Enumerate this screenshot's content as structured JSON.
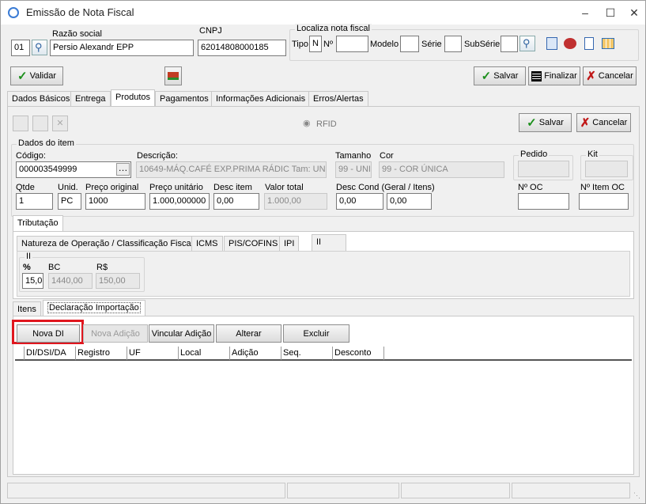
{
  "window": {
    "title": "Emissão de Nota Fiscal"
  },
  "header": {
    "code": "01",
    "razao_social_label": "Razão social",
    "razao_social": "Persio Alexandr EPP",
    "cnpj_label": "CNPJ",
    "cnpj": "62014808000185",
    "localiza_label": "Localiza nota fiscal",
    "tipo_label": "Tipo",
    "tipo": "N",
    "numero_label": "Nº",
    "modelo_label": "Modelo",
    "serie_label": "Série",
    "subserie_label": "SubSérie"
  },
  "toolbar": {
    "validar": "Validar",
    "salvar": "Salvar",
    "finalizar": "Finalizar",
    "cancelar": "Cancelar"
  },
  "tabs": [
    "Dados Básicos",
    "Entrega",
    "Produtos",
    "Pagamentos",
    "Informações Adicionais",
    "Erros/Alertas"
  ],
  "produtos": {
    "rfid": "RFID",
    "salvar": "Salvar",
    "cancelar": "Cancelar",
    "dados_item_label": "Dados do item",
    "codigo_label": "Código:",
    "codigo": "000003549999",
    "descricao_label": "Descrição:",
    "descricao": "10649-MÁQ.CAFÉ EXP.PRIMA RÁDIC Tam: UNI",
    "tamanho_label": "Tamanho",
    "tamanho": "99 - UNI",
    "cor_label": "Cor",
    "cor": "99 - COR ÚNICA",
    "pedido_label": "Pedido",
    "kit_label": "Kit",
    "qtde_label": "Qtde",
    "qtde": "1",
    "unid_label": "Unid.",
    "unid": "PC",
    "preco_original_label": "Preço original",
    "preco_original": "1000",
    "preco_unitario_label": "Preço unitário",
    "preco_unitario": "1.000,000000",
    "desc_item_label": "Desc item",
    "desc_item": "0,00",
    "valor_total_label": "Valor total",
    "valor_total": "1.000,00",
    "desc_cond_label": "Desc Cond (Geral / Itens)",
    "desc_cond_geral": "0,00",
    "desc_cond_itens": "0,00",
    "num_oc_label": "Nº OC",
    "num_item_oc_label": "Nº Item OC"
  },
  "tributacao": {
    "tab": "Tributação",
    "subtabs": [
      "Natureza de Operação / Classificação Fiscal",
      "ICMS",
      "PIS/COFINS",
      "IPI",
      "II"
    ],
    "ii_group": "II",
    "pct_label": "%",
    "pct": "15,0",
    "bc_label": "BC",
    "bc": "1440,00",
    "rs_label": "R$",
    "rs": "150,00"
  },
  "bottom_tabs": [
    "Itens",
    "Declaração Importação"
  ],
  "di_buttons": {
    "nova_di": "Nova DI",
    "nova_adicao": "Nova Adição",
    "vincular_adicao": "Vincular Adição",
    "alterar": "Alterar",
    "excluir": "Excluir"
  },
  "grid_columns": [
    "DI/DSI/DA",
    "Registro",
    "UF",
    "Local",
    "Adição",
    "Seq.",
    "Desconto"
  ],
  "colors": {
    "highlight": "#e0161e",
    "accent": "#1b8f1b"
  }
}
